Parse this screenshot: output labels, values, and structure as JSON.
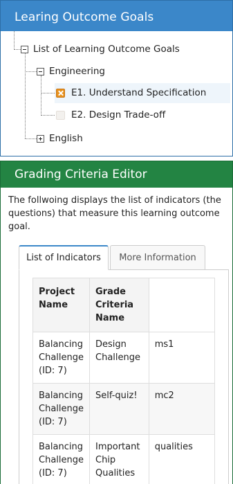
{
  "outcome_panel": {
    "title": "Learing Outcome Goals",
    "tree": {
      "root_label": "List of Learning Outcome Goals",
      "groups": [
        {
          "label": "Engineering",
          "expanded": true,
          "items": [
            {
              "label": "E1. Understand Specification",
              "checked": true
            },
            {
              "label": "E2. Design Trade-off",
              "checked": false
            }
          ]
        },
        {
          "label": "English",
          "expanded": false
        }
      ]
    }
  },
  "criteria_panel": {
    "title": "Grading Criteria Editor",
    "description": "The follwoing displays the list of indicators (the questions) that measure this learning outcome goal.",
    "tabs": [
      "List of Indicators",
      "More Information"
    ],
    "active_tab": "List of Indicators",
    "table": {
      "headers": [
        "Project Name",
        "Grade Criteria Name",
        ""
      ],
      "rows": [
        [
          "Balancing Challenge (ID: 7)",
          "Design Challenge",
          "ms1"
        ],
        [
          "Balancing Challenge (ID: 7)",
          "Self-quiz!",
          "mc2"
        ],
        [
          "Balancing Challenge (ID: 7)",
          "Important Chip Qualities",
          "qualities"
        ]
      ]
    }
  },
  "colors": {
    "outcome_header": "#3b87c9",
    "criteria_header": "#238443",
    "checkbox_checked": "#e8921e"
  }
}
